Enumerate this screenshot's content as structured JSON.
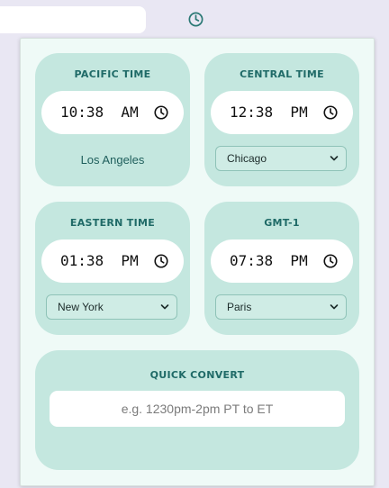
{
  "cards": [
    {
      "title": "PACIFIC TIME",
      "time": "10:38  AM",
      "city": "Los Angeles"
    },
    {
      "title": "CENTRAL TIME",
      "time": "12:38  PM",
      "city_select": "Chicago"
    },
    {
      "title": "EASTERN TIME",
      "time": "01:38  PM",
      "city_select": "New York"
    },
    {
      "title": "GMT-1",
      "time": "07:38  PM",
      "city_select": "Paris"
    }
  ],
  "quick_convert": {
    "title": "QUICK CONVERT",
    "placeholder": "e.g. 1230pm-2pm PT to ET"
  },
  "colors": {
    "card_bg": "#c4e7df",
    "accent": "#1f6a67",
    "popup_bg": "#effaf7"
  },
  "icons": [
    "clock-icon",
    "chevron-down-icon",
    "extension-clock-icon"
  ]
}
